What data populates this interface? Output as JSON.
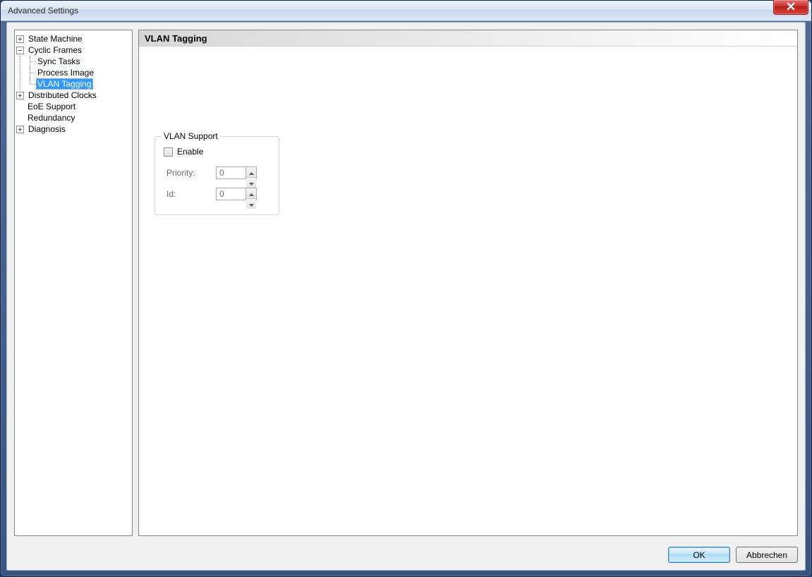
{
  "window": {
    "title": "Advanced Settings"
  },
  "tree": {
    "state_machine": "State Machine",
    "cyclic_frames": "Cyclic Frames",
    "sync_tasks": "Sync Tasks",
    "process_image": "Process Image",
    "vlan_tagging": "VLAN Tagging",
    "distributed_clocks": "Distributed Clocks",
    "eoe_support": "EoE Support",
    "redundancy": "Redundancy",
    "diagnosis": "Diagnosis"
  },
  "panel": {
    "title": "VLAN Tagging",
    "group_title": "VLAN Support",
    "enable_label": "Enable",
    "priority_label": "Priority:",
    "priority_value": "0",
    "id_label": "Id:",
    "id_value": "0"
  },
  "buttons": {
    "ok": "OK",
    "cancel": "Abbrechen"
  }
}
